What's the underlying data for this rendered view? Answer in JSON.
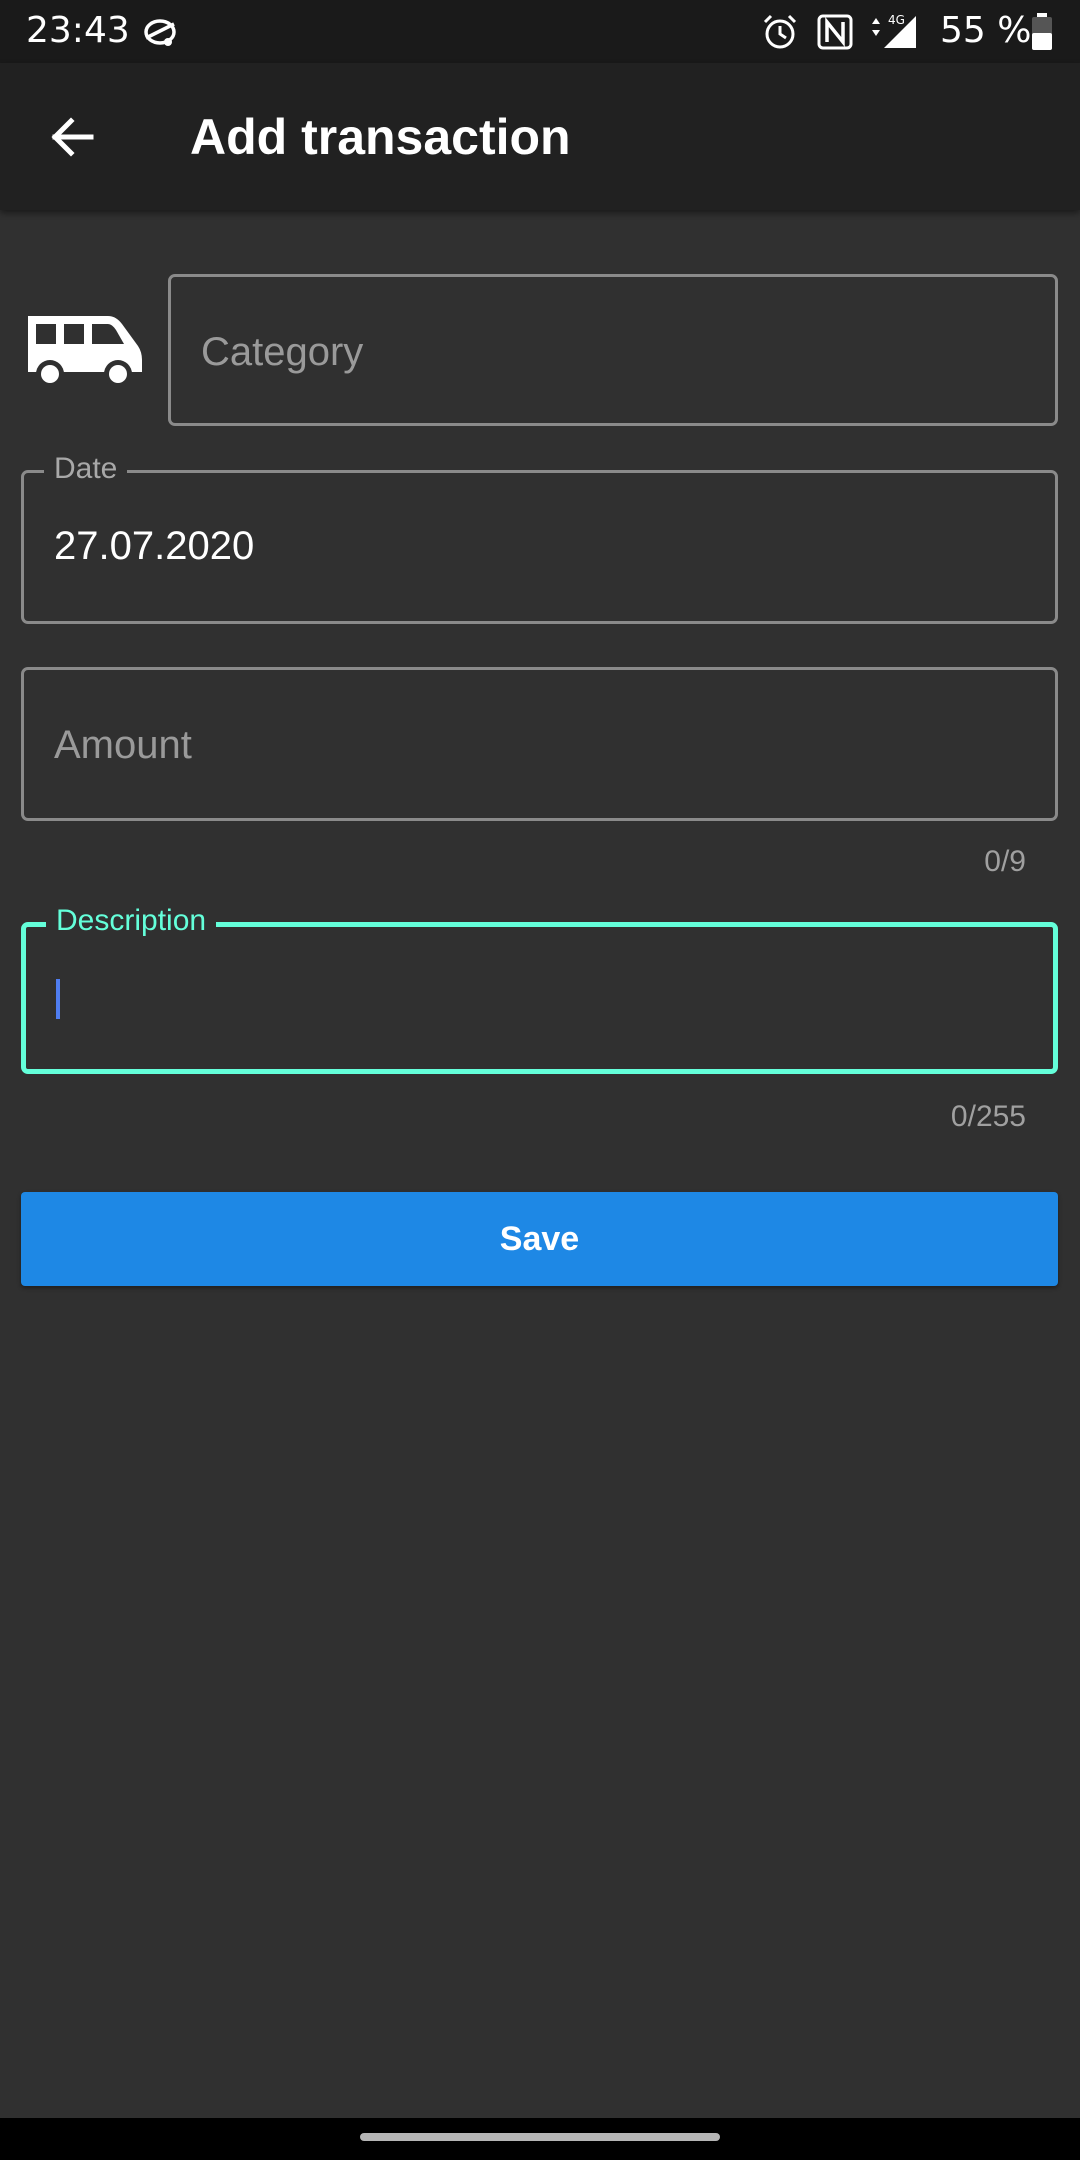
{
  "status_bar": {
    "time": "23:43",
    "network": "4G",
    "battery_percent": "55 %",
    "icons": [
      "sync-icon",
      "alarm-icon",
      "nfc-icon",
      "signal-icon",
      "battery-icon"
    ]
  },
  "app_bar": {
    "title": "Add transaction",
    "back_icon": "arrow-left-icon"
  },
  "form": {
    "category": {
      "icon": "bus-icon",
      "placeholder": "Category",
      "value": ""
    },
    "date": {
      "label": "Date",
      "value": "27.07.2020"
    },
    "amount": {
      "placeholder": "Amount",
      "value": "",
      "counter": "0/9"
    },
    "description": {
      "label": "Description",
      "value": "",
      "counter": "0/255",
      "focused": true
    },
    "save_label": "Save"
  },
  "colors": {
    "background": "#303030",
    "app_bar": "#212121",
    "status_bar": "#1a1a1a",
    "accent_focus": "#64ffda",
    "primary_button": "#1e88e5",
    "caret": "#4f7df0",
    "outline": "#8a8a8a"
  }
}
